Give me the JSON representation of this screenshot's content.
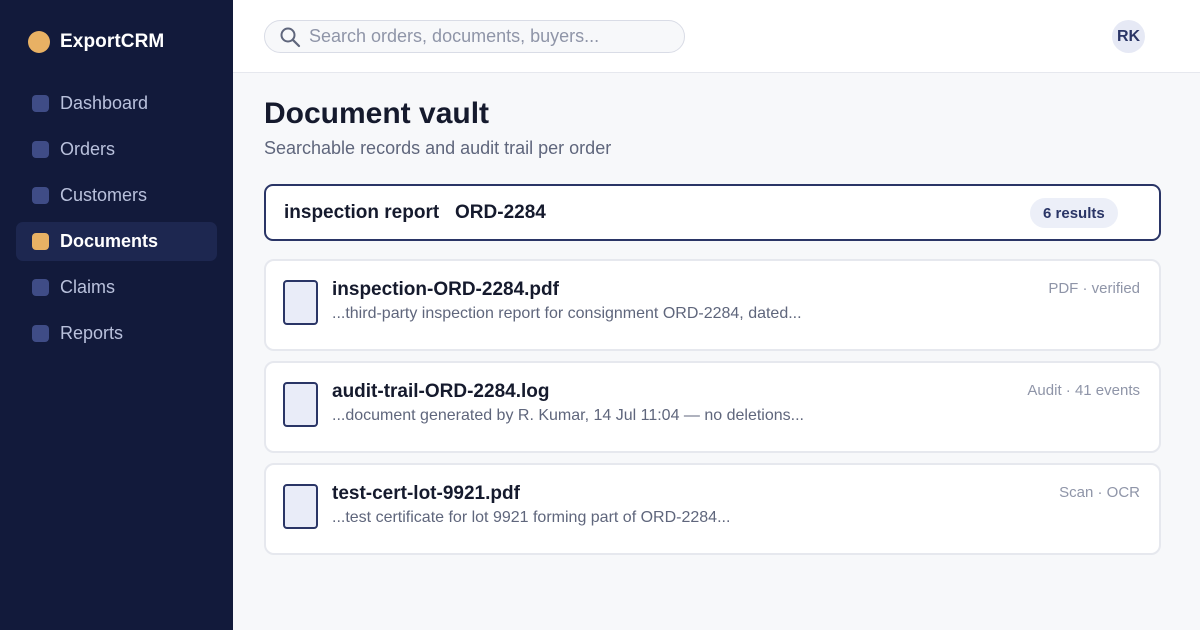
{
  "brand": {
    "name": "ExportCRM",
    "logo_color": "#e8b164"
  },
  "sidebar": {
    "items": [
      {
        "label": "Dashboard",
        "icon": "dashboard-icon",
        "active": false
      },
      {
        "label": "Orders",
        "icon": "orders-icon",
        "active": false
      },
      {
        "label": "Customers",
        "icon": "customers-icon",
        "active": false
      },
      {
        "label": "Documents",
        "icon": "documents-icon",
        "active": true
      },
      {
        "label": "Claims",
        "icon": "claims-icon",
        "active": false
      },
      {
        "label": "Reports",
        "icon": "reports-icon",
        "active": false
      }
    ]
  },
  "topbar": {
    "search": {
      "placeholder": "Search orders, documents, buyers...",
      "value": "",
      "icon": "search-icon"
    },
    "user": {
      "initials": "RK"
    }
  },
  "page": {
    "title": "Document vault",
    "subtitle": "Searchable records and audit trail per order"
  },
  "query": {
    "text": "inspection report   ORD-2284",
    "results_label": "6 results"
  },
  "results": [
    {
      "name": "inspection-ORD-2284.pdf",
      "snippet": "...third-party inspection report for consignment ORD-2284, dated...",
      "meta": "PDF · verified",
      "icon": "document-icon"
    },
    {
      "name": "audit-trail-ORD-2284.log",
      "snippet": "...document generated by R. Kumar, 14 Jul 11:04 — no deletions...",
      "meta": "Audit · 41 events",
      "icon": "document-icon"
    },
    {
      "name": "test-cert-lot-9921.pdf",
      "snippet": "...test certificate for lot 9921 forming part of ORD-2284...",
      "meta": "Scan · OCR",
      "icon": "document-icon"
    }
  ],
  "colors": {
    "sidebar_bg": "#121a3b",
    "accent": "#e8b164",
    "primary": "#2a3566",
    "background": "#f7f8fa"
  }
}
